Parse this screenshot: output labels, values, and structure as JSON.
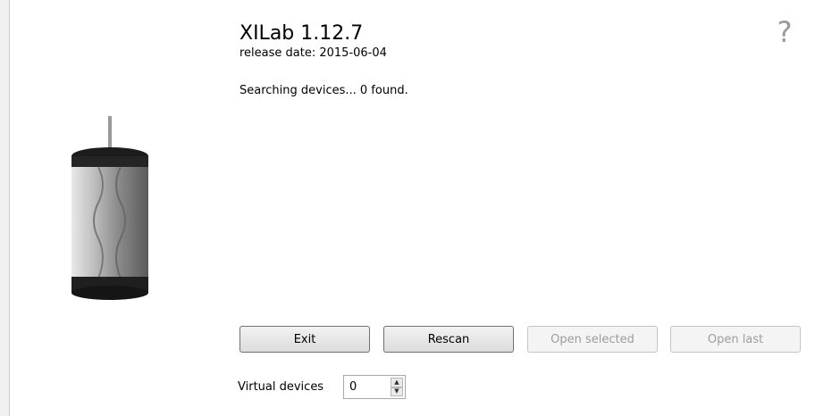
{
  "app": {
    "title": "XILab 1.12.7",
    "release_date": "release date: 2015-06-04"
  },
  "status": "Searching devices... 0 found.",
  "help_icon": "question-mark-icon",
  "buttons": {
    "exit": "Exit",
    "rescan": "Rescan",
    "open_selected": "Open selected",
    "open_last": "Open last"
  },
  "virtual_devices": {
    "label": "Virtual devices",
    "value": "0"
  },
  "colors": {
    "help_icon": "#9a9a9a",
    "disabled_text": "#9d9d9d"
  }
}
